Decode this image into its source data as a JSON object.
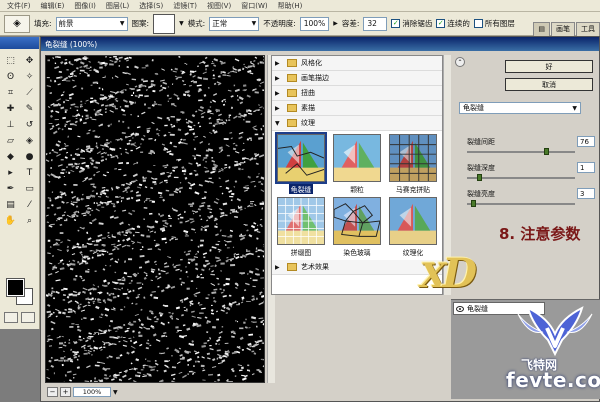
{
  "menu": [
    "文件(F)",
    "编辑(E)",
    "图像(I)",
    "图层(L)",
    "选择(S)",
    "滤镜(T)",
    "视图(V)",
    "窗口(W)",
    "帮助(H)"
  ],
  "options": {
    "fill_label": "填充:",
    "fill_value": "前景",
    "pattern_label": "图案:",
    "mode_label": "模式:",
    "mode_value": "正常",
    "opacity_label": "不透明度:",
    "opacity_value": "100%",
    "tolerance_label": "容差:",
    "tolerance_value": "32",
    "antialias_label": "消除锯齿",
    "antialias_checked": true,
    "contiguous_label": "连续的",
    "contiguous_checked": true,
    "all_layers_label": "所有图层",
    "all_layers_checked": false,
    "tab_brushes": "画笔",
    "tab_tools": "工具"
  },
  "dialog": {
    "title": "龟裂缝 (100%)",
    "zoom_minus": "−",
    "zoom_plus": "+",
    "zoom_value": "100%",
    "ok_label": "好",
    "cancel_label": "取消",
    "filter_select": "龟裂缝"
  },
  "filter_categories": [
    {
      "name": "风格化",
      "expanded": false
    },
    {
      "name": "画笔描边",
      "expanded": false
    },
    {
      "name": "扭曲",
      "expanded": false
    },
    {
      "name": "素描",
      "expanded": false
    },
    {
      "name": "纹理",
      "expanded": true
    },
    {
      "name": "艺术效果",
      "expanded": false
    }
  ],
  "texture_filters": [
    {
      "label": "龟裂缝",
      "selected": true
    },
    {
      "label": "颗粒",
      "selected": false
    },
    {
      "label": "马赛克拼贴",
      "selected": false
    },
    {
      "label": "拼缀图",
      "selected": false
    },
    {
      "label": "染色玻璃",
      "selected": false
    },
    {
      "label": "纹理化",
      "selected": false
    }
  ],
  "params": [
    {
      "label": "裂缝间距",
      "value": "76",
      "fraction": 0.74
    },
    {
      "label": "裂缝深度",
      "value": "1",
      "fraction": 0.1
    },
    {
      "label": "裂缝亮度",
      "value": "3",
      "fraction": 0.04
    }
  ],
  "annotation": "8. 注意参数",
  "layer_label": "龟裂缝",
  "watermark_logo": "XD",
  "brand_cn": "飞特网",
  "brand_url": "fevte.com",
  "colors": {
    "titlebar": "#0a246a",
    "annotation": "#7a1717",
    "brand": "#4d63d6"
  }
}
